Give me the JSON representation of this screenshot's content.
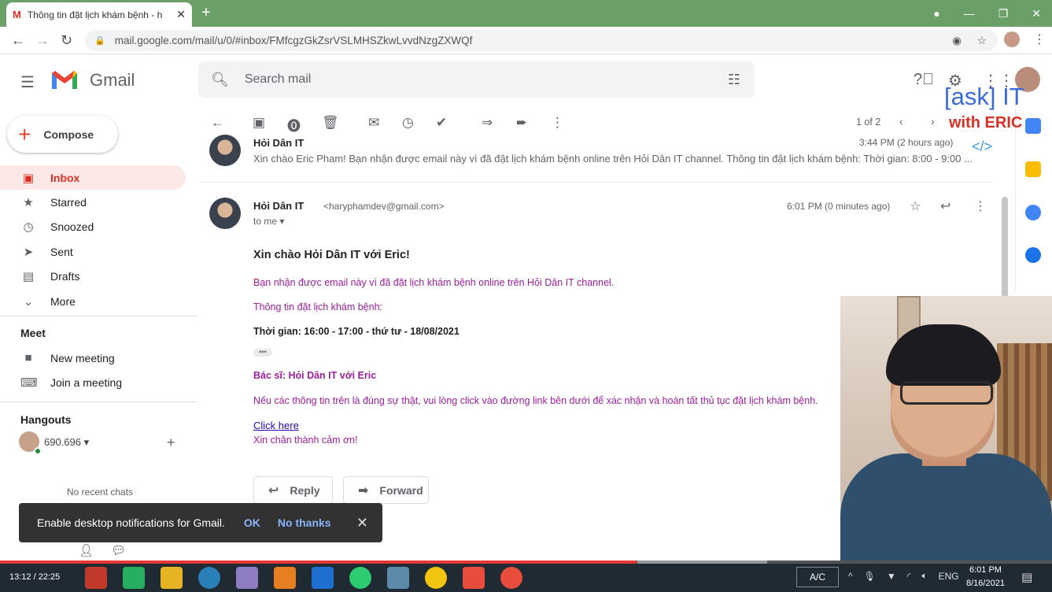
{
  "browser": {
    "tab_title": "Thông tin đặt lịch khám bệnh - h",
    "tab_close": "✕",
    "new_tab": "+",
    "url": "mail.google.com/mail/u/0/#inbox/FMfcgzGkZsrVSLMHSZkwLvvdNzgZXWQf"
  },
  "gmail": {
    "logo_text": "Gmail",
    "search_placeholder": "Search mail",
    "compose_label": "Compose",
    "nav": [
      {
        "label": "Inbox",
        "icon": "inbox-icon",
        "glyph": "▣"
      },
      {
        "label": "Starred",
        "icon": "star-icon",
        "glyph": "★"
      },
      {
        "label": "Snoozed",
        "icon": "clock-icon",
        "glyph": "◷"
      },
      {
        "label": "Sent",
        "icon": "send-icon",
        "glyph": "➤"
      },
      {
        "label": "Drafts",
        "icon": "draft-icon",
        "glyph": "▤"
      },
      {
        "label": "More",
        "icon": "chevron-down-icon",
        "glyph": "⌄"
      }
    ],
    "meet": {
      "heading": "Meet",
      "new_meeting": "New meeting",
      "join_meeting": "Join a meeting"
    },
    "hangouts": {
      "heading": "Hangouts",
      "user": "690.696",
      "no_chats": "No recent chats"
    },
    "pager": "1 of 2"
  },
  "thread": {
    "prev_message": {
      "sender": "Hỏi Dân IT",
      "time": "3:44 PM (2 hours ago)",
      "snippet": "Xin chào Eric Pham! Bạn nhận được email này vì đã đặt lịch khám bệnh online trên Hỏi Dân IT channel. Thông tin đặt lịch khám bệnh: Thời gian: 8:00 - 9:00 ..."
    },
    "message": {
      "sender": "Hỏi Dân IT",
      "email": "<haryphamdev@gmail.com>",
      "to": "to me",
      "time": "6:01 PM (0 minutes ago)",
      "greeting": "Xin chào Hỏi Dân IT với Eric!",
      "line1": "Bạn nhận được email này vì đã đặt lịch khám bệnh online trên Hỏi Dân IT channel.",
      "line2": "Thông tin đặt lịch khám bệnh:",
      "time_line": "Thời gian: 16:00 - 17:00 - thứ tư - 18/08/2021",
      "dots": "•••",
      "doctor": "Bác sĩ: Hỏi Dân IT với Eric",
      "line3": "Nếu các thông tin trên là đúng sự thật, vui lòng click vào đường link bên dưới để xác nhận và hoàn tất thủ tục đặt lịch khám bệnh.",
      "link": "Click here",
      "thanks": "Xin chân thành cảm ơn!"
    },
    "reply_label": "Reply",
    "forward_label": "Forward"
  },
  "toast": {
    "text": "Enable desktop notifications for Gmail.",
    "ok": "OK",
    "no": "No thanks"
  },
  "watermark": {
    "line1": "[ask] IT",
    "line2": "with ERIC",
    "line3": "</>"
  },
  "video": {
    "time": "13:12 / 22:25",
    "progress": 0.605
  },
  "taskbar": {
    "tray": "A/C",
    "lang": "ENG",
    "time": "6:01 PM",
    "date": "8/16/2021"
  },
  "colors": {
    "accent": "#d93025",
    "purple": "#9b1e9b",
    "tab_bar": "#6a9f68"
  }
}
